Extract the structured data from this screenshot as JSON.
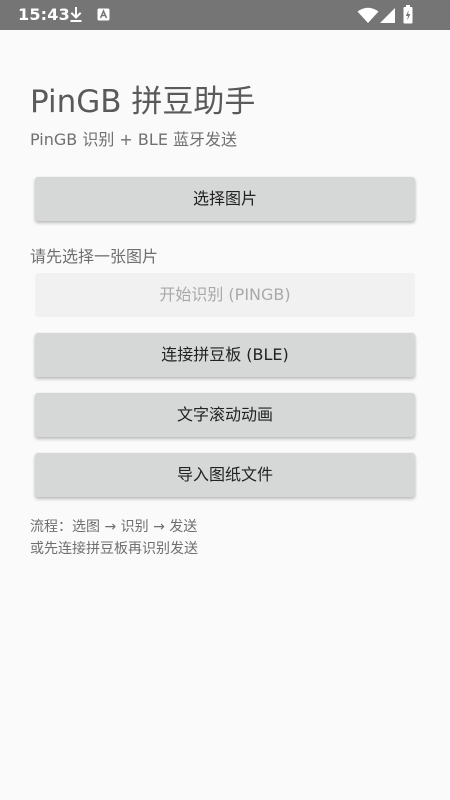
{
  "status_bar": {
    "time": "15:43",
    "icons_left": [
      "download-icon",
      "android-icon"
    ],
    "icons_right": [
      "wifi-icon",
      "cellular-signal-icon",
      "battery-charging-icon"
    ],
    "background": "#757575"
  },
  "header": {
    "title": "PinGB 拼豆助手",
    "subtitle": "PinGB 识别 + BLE 蓝牙发送"
  },
  "actions": {
    "select_image": "选择图片",
    "hint": "请先选择一张图片",
    "start_recognition": "开始识别 (PINGB)",
    "start_recognition_enabled": false,
    "connect_board": "连接拼豆板 (BLE)",
    "text_scroll_animation": "文字滚动动画",
    "import_pattern": "导入图纸文件"
  },
  "footer": {
    "flow_line1": "流程：选图 → 识别 → 发送",
    "flow_line2": "或先连接拼豆板再识别发送"
  },
  "colors": {
    "background": "#fafafa",
    "button": "#d6d7d7",
    "button_disabled": "#f1f1f1"
  }
}
